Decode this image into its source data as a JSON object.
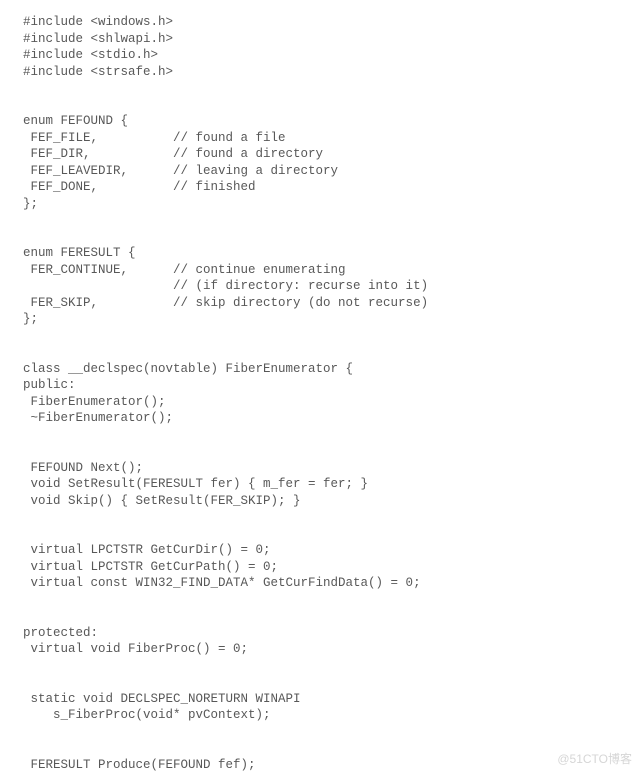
{
  "code": {
    "lines": [
      "#include <windows.h>",
      "#include <shlwapi.h>",
      "#include <stdio.h>",
      "#include <strsafe.h>",
      "",
      "",
      "enum FEFOUND {",
      " FEF_FILE,          // found a file",
      " FEF_DIR,           // found a directory",
      " FEF_LEAVEDIR,      // leaving a directory",
      " FEF_DONE,          // finished",
      "};",
      "",
      "",
      "enum FERESULT {",
      " FER_CONTINUE,      // continue enumerating",
      "                    // (if directory: recurse into it)",
      " FER_SKIP,          // skip directory (do not recurse)",
      "};",
      "",
      "",
      "class __declspec(novtable) FiberEnumerator {",
      "public:",
      " FiberEnumerator();",
      " ~FiberEnumerator();",
      "",
      "",
      " FEFOUND Next();",
      " void SetResult(FERESULT fer) { m_fer = fer; }",
      " void Skip() { SetResult(FER_SKIP); }",
      "",
      "",
      " virtual LPCTSTR GetCurDir() = 0;",
      " virtual LPCTSTR GetCurPath() = 0;",
      " virtual const WIN32_FIND_DATA* GetCurFindData() = 0;",
      "",
      "",
      "protected:",
      " virtual void FiberProc() = 0;",
      "",
      "",
      " static void DECLSPEC_NORETURN WINAPI",
      "    s_FiberProc(void* pvContext);",
      "",
      "",
      " FERESULT Produce(FEFOUND fef);"
    ]
  },
  "watermark": "@51CTO博客"
}
